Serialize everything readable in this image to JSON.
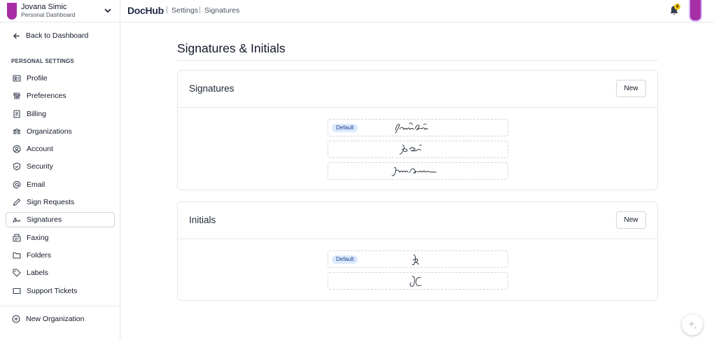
{
  "account": {
    "name": "Jovana Simic",
    "subtitle": "Personal Dashboard",
    "avatar_color": "#a72fa6"
  },
  "topbar": {
    "logo": "DocHub",
    "breadcrumbs": [
      "Settings",
      "Signatures"
    ],
    "notification_count": "4"
  },
  "sidebar": {
    "back_label": "Back to Dashboard",
    "section_title": "PERSONAL SETTINGS",
    "items": [
      {
        "label": "Profile",
        "icon": "profile-icon"
      },
      {
        "label": "Preferences",
        "icon": "sliders-icon"
      },
      {
        "label": "Billing",
        "icon": "receipt-icon"
      },
      {
        "label": "Organizations",
        "icon": "team-icon"
      },
      {
        "label": "Account",
        "icon": "user-circle-icon"
      },
      {
        "label": "Security",
        "icon": "shield-icon"
      },
      {
        "label": "Email",
        "icon": "at-icon"
      },
      {
        "label": "Sign Requests",
        "icon": "pen-icon"
      },
      {
        "label": "Signatures",
        "icon": "signature-icon",
        "active": true
      },
      {
        "label": "Faxing",
        "icon": "fax-icon"
      },
      {
        "label": "Folders",
        "icon": "folder-icon"
      },
      {
        "label": "Labels",
        "icon": "tag-icon"
      },
      {
        "label": "Support Tickets",
        "icon": "ticket-icon"
      }
    ],
    "new_org_label": "New Organization"
  },
  "main": {
    "page_title": "Signatures & Initials",
    "signatures": {
      "title": "Signatures",
      "new_label": "New",
      "default_label": "Default"
    },
    "initials": {
      "title": "Initials",
      "new_label": "New",
      "default_label": "Default"
    }
  },
  "colors": {
    "accent": "#a72fa6",
    "badge": "#f5c518",
    "default_pill": "#dbeafe"
  }
}
